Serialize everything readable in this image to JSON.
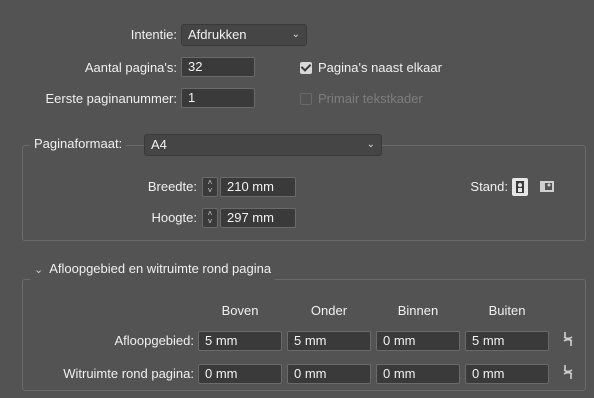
{
  "top": {
    "intent_label": "Intentie:",
    "intent_value": "Afdrukken",
    "pages_label": "Aantal pagina's:",
    "pages_value": "32",
    "first_page_label": "Eerste paginanummer:",
    "first_page_value": "1",
    "facing_pages_label": "Pagina's naast elkaar",
    "facing_pages_checked": true,
    "primary_frame_label": "Primair tekstkader",
    "primary_frame_checked": false
  },
  "page_size": {
    "label": "Paginaformaat:",
    "value": "A4",
    "width_label": "Breedte:",
    "width_value": "210 mm",
    "height_label": "Hoogte:",
    "height_value": "297 mm",
    "orientation_label": "Stand:",
    "orientation_selected": "portrait"
  },
  "bleed": {
    "section_title": "Afloopgebied en witruimte rond pagina",
    "columns": [
      "Boven",
      "Onder",
      "Binnen",
      "Buiten"
    ],
    "bleed_label": "Afloopgebied:",
    "bleed_values": [
      "5 mm",
      "5 mm",
      "0 mm",
      "5 mm"
    ],
    "slug_label": "Witruimte rond pagina:",
    "slug_values": [
      "0 mm",
      "0 mm",
      "0 mm",
      "0 mm"
    ]
  },
  "colors": {
    "background": "#535353",
    "field_background": "#3a3a3a",
    "text": "#f0f0f0"
  }
}
